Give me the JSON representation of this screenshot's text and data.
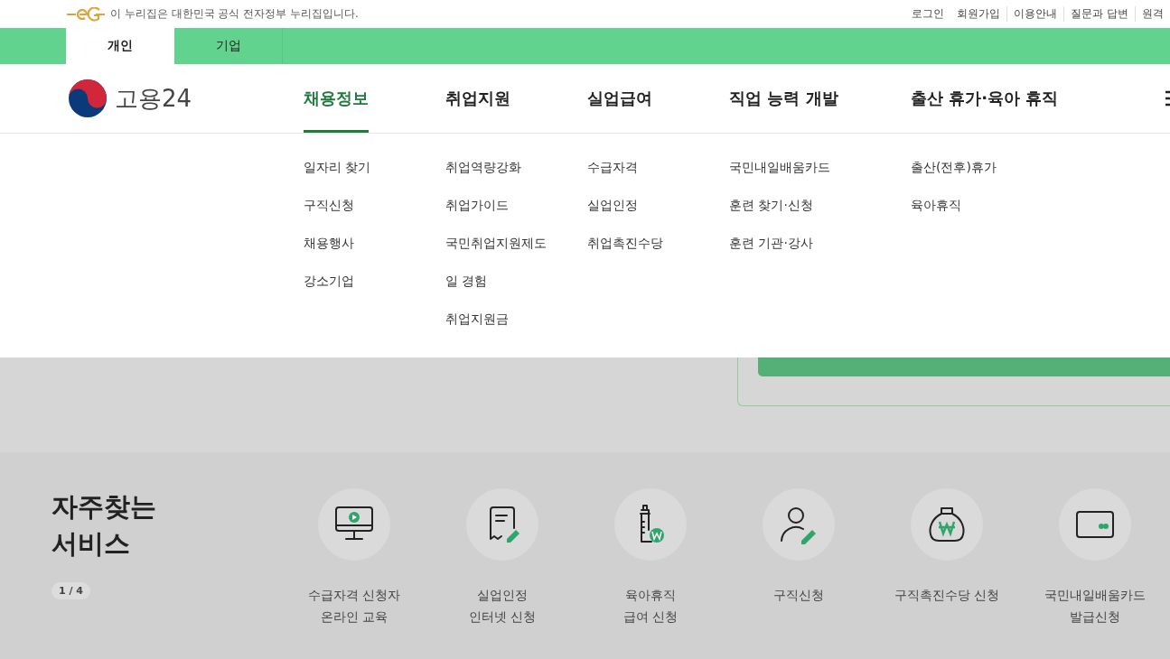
{
  "top_bar": {
    "notice": "이 누리집은 대한민국 공식 전자정부 누리집입니다.",
    "links": [
      "로그인",
      "회원가입",
      "이용안내",
      "질문과 답변",
      "원격"
    ]
  },
  "audience_tabs": [
    {
      "label": "개인",
      "selected": true
    },
    {
      "label": "기업",
      "selected": false
    }
  ],
  "logo": {
    "text": "고용24"
  },
  "nav": [
    {
      "label": "채용정보",
      "selected": true,
      "submenu": [
        "일자리 찾기",
        "구직신청",
        "채용행사",
        "강소기업"
      ]
    },
    {
      "label": "취업지원",
      "selected": false,
      "submenu": [
        "취업역량강화",
        "취업가이드",
        "국민취업지원제도",
        "일 경험",
        "취업지원금"
      ]
    },
    {
      "label": "실업급여",
      "selected": false,
      "submenu": [
        "수급자격",
        "실업인정",
        "취업촉진수당"
      ]
    },
    {
      "label": "직업 능력 개발",
      "selected": false,
      "submenu": [
        "국민내일배움카드",
        "훈련 찾기·신청",
        "훈련 기관·강사"
      ]
    },
    {
      "label": "출산 휴가·육아 휴직",
      "selected": false,
      "submenu": [
        "출산(전후)휴가",
        "육아휴직"
      ]
    }
  ],
  "services": {
    "title": "자주찾는\n서비스",
    "pager": "1 / 4",
    "items": [
      {
        "kind": "monitor",
        "label": "수급자격 신청자\n온라인 교육"
      },
      {
        "kind": "document",
        "label": "실업인정\n인터넷 신청"
      },
      {
        "kind": "bottle",
        "label": "육아휴직\n급여 신청"
      },
      {
        "kind": "person",
        "label": "구직신청"
      },
      {
        "kind": "moneybag",
        "label": "구직촉진수당 신청"
      },
      {
        "kind": "card",
        "label": "국민내일배움카드\n발급신청"
      }
    ]
  }
}
